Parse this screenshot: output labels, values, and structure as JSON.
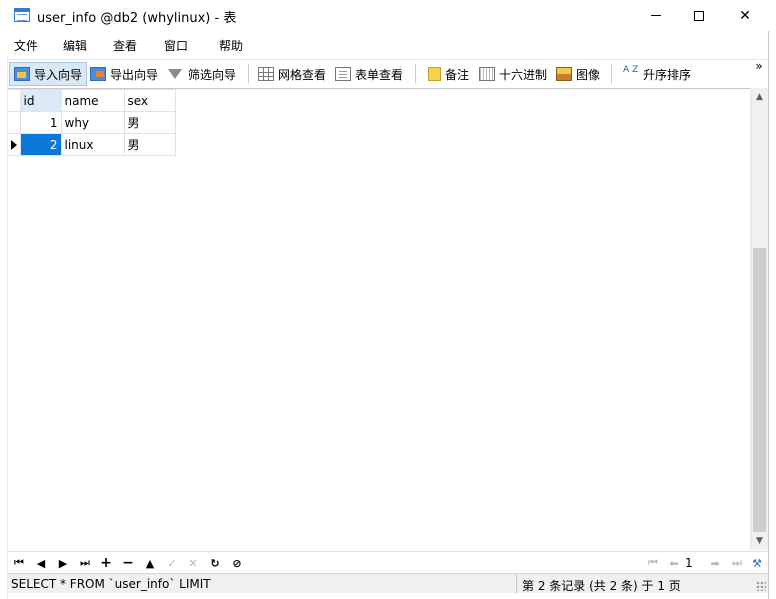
{
  "window": {
    "title": "user_info @db2 (whylinux) - 表",
    "minimize_symbol": "",
    "maximize_symbol": "",
    "close_symbol": "✕"
  },
  "menu": [
    "文件",
    "编辑",
    "查看",
    "窗口",
    "帮助"
  ],
  "toolbar": {
    "items": [
      {
        "label": "导入向导",
        "icon": "import-wizard-icon"
      },
      {
        "label": "导出向导",
        "icon": "export-wizard-icon"
      },
      {
        "label": "筛选向导",
        "icon": "filter-icon"
      },
      {
        "label": "网格查看",
        "icon": "grid-view-icon"
      },
      {
        "label": "表单查看",
        "icon": "form-view-icon"
      },
      {
        "label": "备注",
        "icon": "note-icon"
      },
      {
        "label": "十六进制",
        "icon": "hex-icon"
      },
      {
        "label": "图像",
        "icon": "image-icon"
      },
      {
        "label": "升序排序",
        "icon": "sort-ascending-icon"
      }
    ],
    "more_symbol": "»",
    "sort_icon_text": "A Z"
  },
  "table": {
    "columns": [
      "id",
      "name",
      "sex"
    ],
    "rows": [
      {
        "id": "1",
        "name": "why",
        "sex": "男"
      },
      {
        "id": "2",
        "name": "linux",
        "sex": "男"
      }
    ],
    "selected_row": 2
  },
  "navigation": {
    "first": "⏮",
    "prev": "◀",
    "next": "▶",
    "last": "⏭",
    "add": "+",
    "delete": "−",
    "apply": "▲",
    "check": "✓",
    "cancel": "✕",
    "refresh": "↻",
    "stop": "⊘",
    "page_first": "⏮",
    "page_prev": "⬅",
    "page_number": "1",
    "page_next": "➡",
    "page_last": "⏭",
    "settings": "⚒"
  },
  "status": {
    "sql": "SELECT * FROM `user_info` LIMIT",
    "record_info": "第 2 条记录 (共 2 条) 于 1 页"
  },
  "colors": {
    "selection": "#0a78d7",
    "header_active": "#dceaf7",
    "toolbar_active": "#d9e8f7"
  }
}
